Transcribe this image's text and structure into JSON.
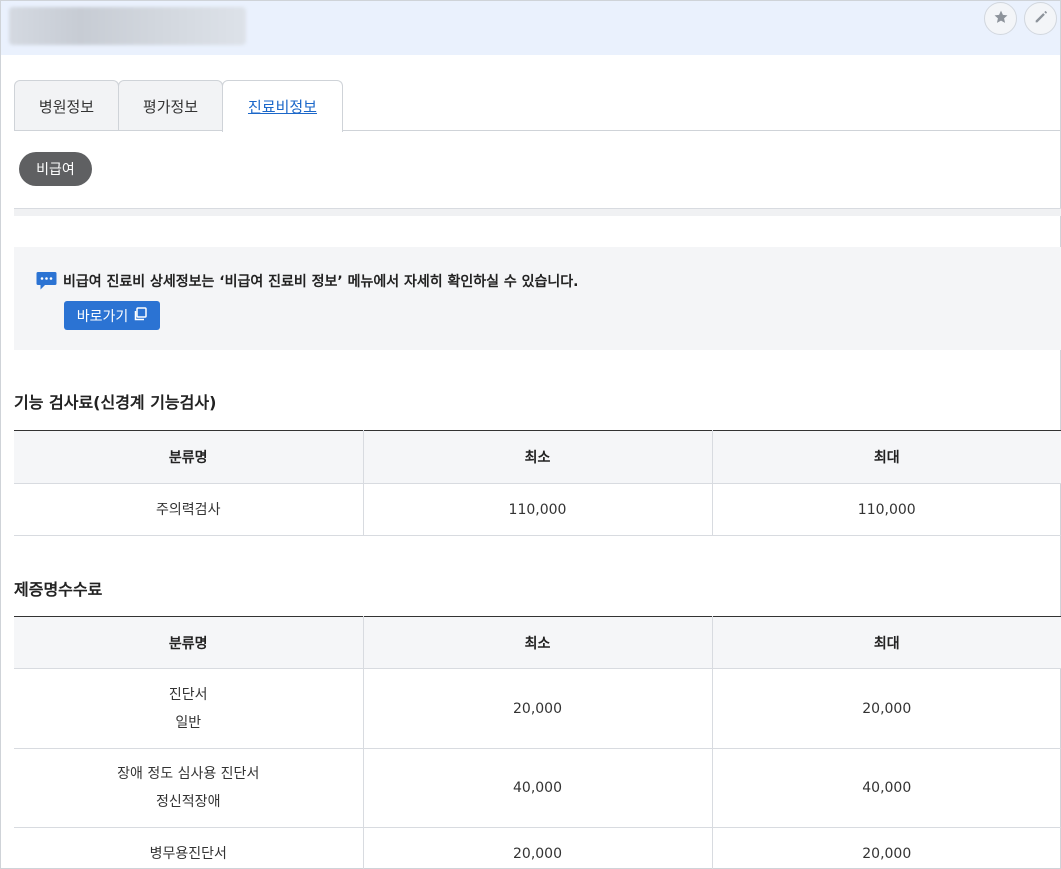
{
  "header": {
    "title_blurred": "",
    "actions": [
      {
        "name": "favorite",
        "icon": "star-icon"
      },
      {
        "name": "edit",
        "icon": "pencil-icon"
      }
    ]
  },
  "tabs": [
    {
      "label": "병원정보",
      "active": false
    },
    {
      "label": "평가정보",
      "active": false
    },
    {
      "label": "진료비정보",
      "active": true
    }
  ],
  "filter_pill": "비급여",
  "notice": {
    "icon": "chat-bubble-icon",
    "text": "비급여 진료비 상세정보는 ‘비급여 진료비 정보’ 메뉴에서 자세히 확인하실 수 있습니다.",
    "button_label": "바로가기",
    "button_icon": "external-window-icon"
  },
  "sections": [
    {
      "title": "기능 검사료(신경계 기능검사)",
      "columns": [
        "분류명",
        "최소",
        "최대"
      ],
      "rows": [
        {
          "name": [
            "주의력검사"
          ],
          "min": "110,000",
          "max": "110,000"
        }
      ]
    },
    {
      "title": "제증명수수료",
      "columns": [
        "분류명",
        "최소",
        "최대"
      ],
      "rows": [
        {
          "name": [
            "진단서",
            "일반"
          ],
          "min": "20,000",
          "max": "20,000"
        },
        {
          "name": [
            "장애 정도 심사용 진단서",
            "정신적장애"
          ],
          "min": "40,000",
          "max": "40,000"
        },
        {
          "name": [
            "병무용진단서"
          ],
          "min": "20,000",
          "max": "20,000"
        }
      ]
    }
  ],
  "colors": {
    "header_bg": "#eaf1fd",
    "active_tab": "#1b67c9",
    "pill_bg": "#5f6062",
    "button_bg": "#2b73d3",
    "notice_bg": "#f4f5f7"
  }
}
